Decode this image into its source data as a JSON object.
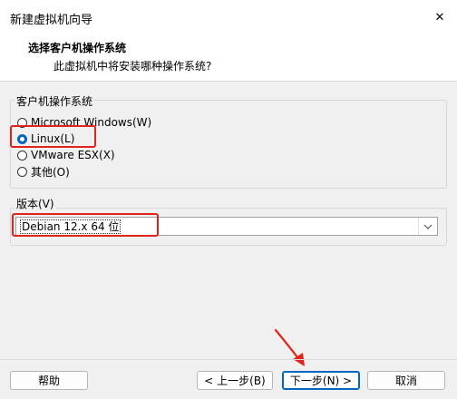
{
  "window": {
    "title": "新建虚拟机向导",
    "close_glyph": "✕"
  },
  "header": {
    "title": "选择客户机操作系统",
    "subtitle": "此虚拟机中将安装哪种操作系统?"
  },
  "os_group": {
    "legend": "客户机操作系统",
    "options": [
      {
        "label": "Microsoft Windows(W)",
        "checked": false
      },
      {
        "label": "Linux(L)",
        "checked": true
      },
      {
        "label": "VMware ESX(X)",
        "checked": false
      },
      {
        "label": "其他(O)",
        "checked": false
      }
    ]
  },
  "version_group": {
    "legend": "版本(V)",
    "selected": "Debian 12.x 64 位"
  },
  "buttons": {
    "help": "帮助",
    "back": "< 上一步(B)",
    "next": "下一步(N) >",
    "cancel": "取消"
  },
  "colors": {
    "highlight": "#e2231a",
    "accent": "#0067c0"
  }
}
